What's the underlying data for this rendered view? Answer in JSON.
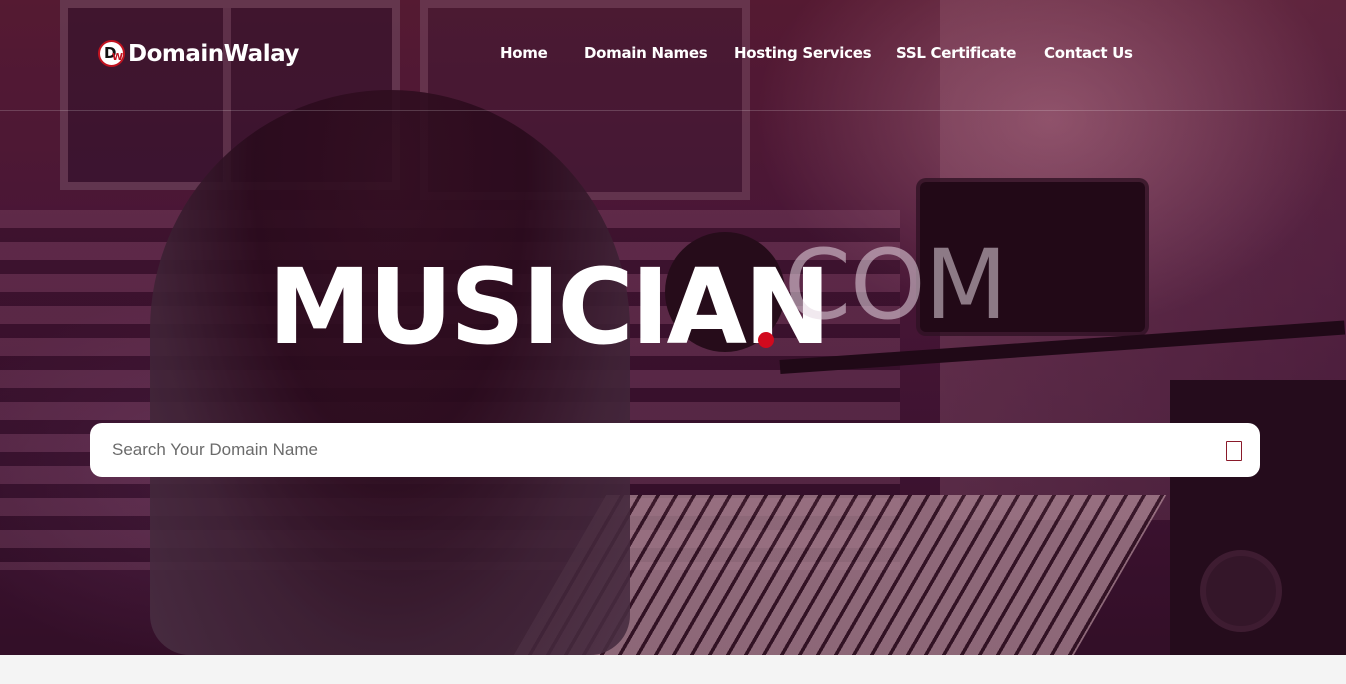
{
  "brand": {
    "name": "DomainWalay",
    "mark_letters": [
      "D",
      "W"
    ],
    "accent_color": "#d10a1e"
  },
  "nav": {
    "items": [
      {
        "label": "Home"
      },
      {
        "label": "Domain Names"
      },
      {
        "label": "Hosting Services"
      },
      {
        "label": "SSL Certificate"
      },
      {
        "label": "Contact Us"
      }
    ]
  },
  "hero": {
    "domain_name": "MUSICIAN",
    "domain_extension": "COM",
    "search": {
      "placeholder": "Search Your Domain Name",
      "value": ""
    }
  }
}
